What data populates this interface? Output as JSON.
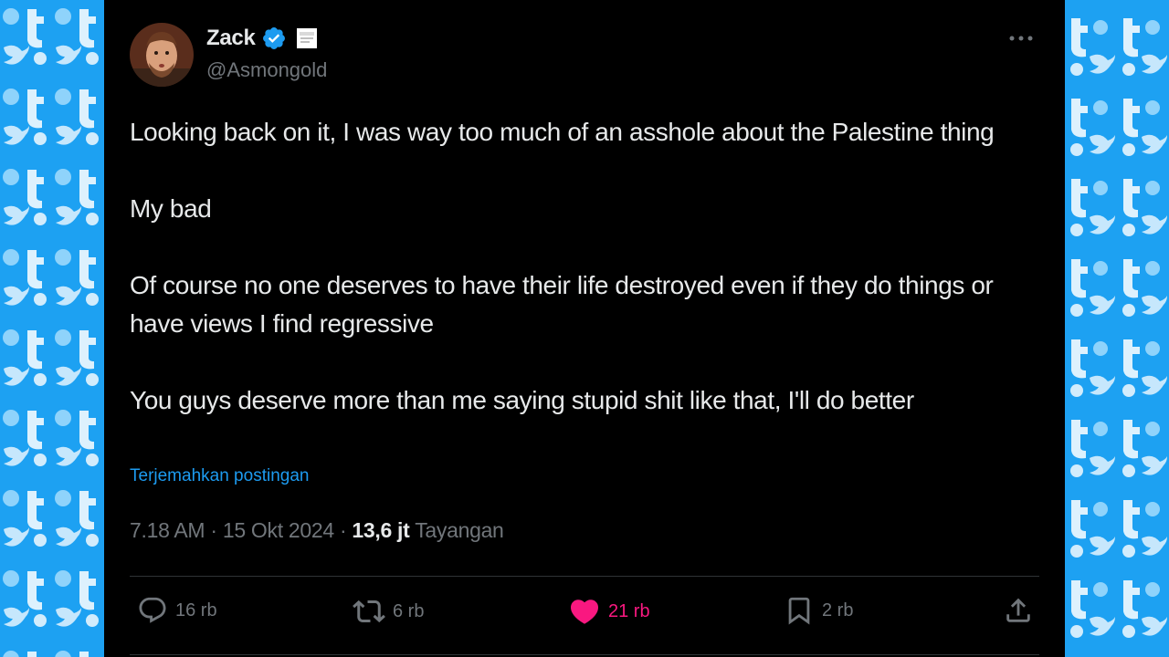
{
  "colors": {
    "background_pattern": "#1da1f2",
    "tweet_bg": "#000000",
    "text": "#e7e9ea",
    "muted": "#71767b",
    "link": "#1d9bf0",
    "like": "#f91880",
    "verified": "#1d9bf0"
  },
  "author": {
    "name": "Zack",
    "handle": "@Asmongold",
    "verified_icon": "verified-badge-icon",
    "affiliation_icon": "affiliate-badge-icon"
  },
  "tweet": {
    "paragraphs": [
      "Looking back on it, I was way too much of an asshole about the Palestine thing",
      "My bad",
      "Of course no one deserves to have their life destroyed even if they do things or have views I find regressive",
      "You guys deserve more than me saying stupid shit like that, I'll do better"
    ],
    "translate_label": "Terjemahkan postingan",
    "time": "7.18 AM",
    "date": "15 Okt 2024",
    "views_count": "13,6 jt",
    "views_label": "Tayangan"
  },
  "actions": {
    "replies": "16 rb",
    "reposts": "6 rb",
    "likes": "21 rb",
    "bookmarks": "2 rb"
  }
}
